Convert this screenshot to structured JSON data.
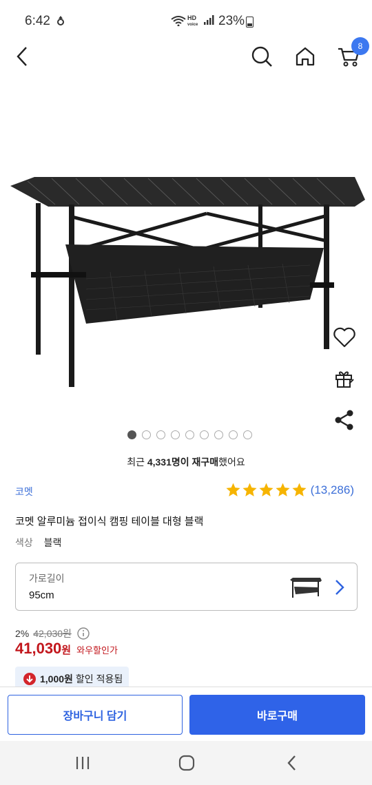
{
  "status_bar": {
    "time": "6:42",
    "left_icon": "settings-sync-icon",
    "hd_label": "HD",
    "voice_label": "voice",
    "battery": "23%"
  },
  "top_nav": {
    "icons": [
      "back-icon",
      "search-icon",
      "home-icon",
      "cart-icon"
    ],
    "cart_count": "8"
  },
  "gallery": {
    "image": "folding-aluminum-camping-table",
    "total_images": 9,
    "active_index": 0
  },
  "repurchase": {
    "prefix": "최근 ",
    "highlight": "4,331명이 재구매",
    "suffix": "했어요"
  },
  "product": {
    "brand": "코멧",
    "rating": 5,
    "review_count": "(13,286)",
    "title": "코멧 알루미늄 접이식 캠핑 테이블 대형 블랙",
    "color_label": "색상",
    "color_value": "블랙"
  },
  "option": {
    "label": "가로길이",
    "value": "95cm"
  },
  "pricing": {
    "discount_rate": "2%",
    "original_price": "42,030원",
    "price": "41,030",
    "price_unit": "원",
    "price_tag": "와우할인가",
    "coupon_amount": "1,000원",
    "coupon_text": "할인 적용됨"
  },
  "actions": {
    "cart_label": "장바구니 담기",
    "buy_label": "바로구매"
  },
  "colors": {
    "accent_blue": "#2f63e8",
    "price_red": "#c2161c",
    "badge_blue": "#3c78f0",
    "star_yellow": "#f6b400"
  }
}
